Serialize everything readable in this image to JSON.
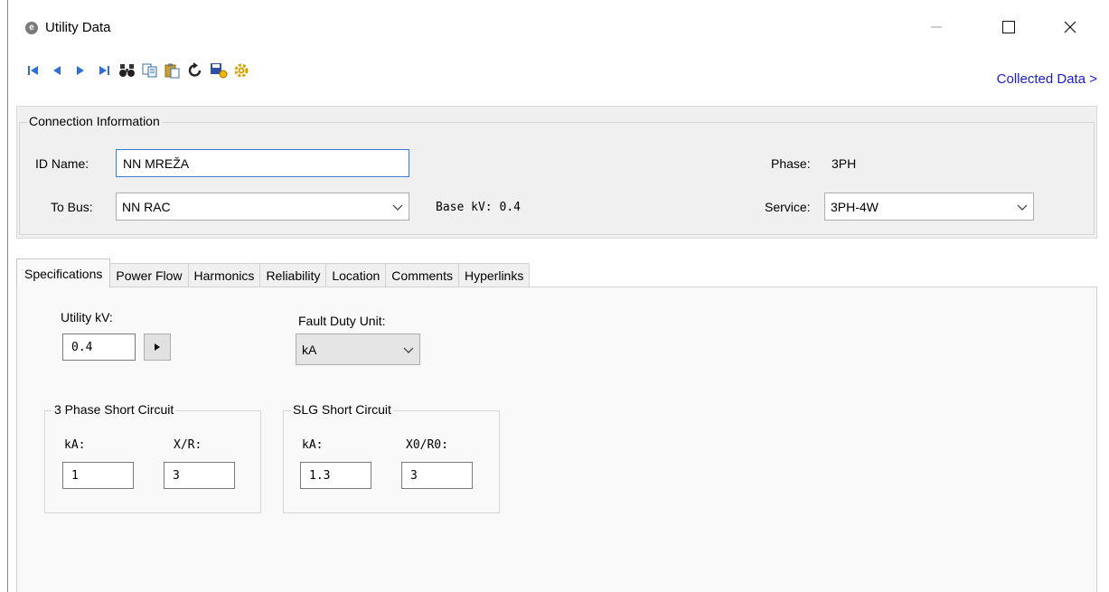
{
  "window": {
    "title": "Utility Data",
    "app_icon_glyph": "e"
  },
  "toolbar": {
    "buttons": [
      {
        "name": "first-record-icon",
        "color": "#2f6fd6"
      },
      {
        "name": "previous-record-icon",
        "color": "#2f6fd6"
      },
      {
        "name": "next-record-icon",
        "color": "#2f6fd6"
      },
      {
        "name": "last-record-icon",
        "color": "#2f6fd6"
      },
      {
        "name": "find-binoculars-icon",
        "color": "#2a2a2a"
      },
      {
        "name": "copy-icon",
        "color": "#3a6ea8"
      },
      {
        "name": "paste-icon",
        "color": "#c9a13a"
      },
      {
        "name": "undo-icon",
        "color": "#222222"
      },
      {
        "name": "save-library-icon",
        "color": "#3050a8"
      },
      {
        "name": "settings-icon",
        "color": "#d8a000"
      }
    ],
    "collected_data_link": "Collected Data >"
  },
  "connection": {
    "legend": "Connection Information",
    "id_label": "ID Name:",
    "id_value": "NN MREŽA",
    "to_bus_label": "To Bus:",
    "to_bus_value": "NN RAC",
    "base_kv_text": "Base kV: 0.4",
    "phase_label": "Phase:",
    "phase_value": "3PH",
    "service_label": "Service:",
    "service_value": "3PH-4W"
  },
  "tabs": [
    {
      "label": "Specifications",
      "active": true
    },
    {
      "label": "Power Flow"
    },
    {
      "label": "Harmonics"
    },
    {
      "label": "Reliability"
    },
    {
      "label": "Location"
    },
    {
      "label": "Comments"
    },
    {
      "label": "Hyperlinks"
    }
  ],
  "specifications": {
    "utility_kv_label": "Utility kV:",
    "utility_kv_value": "0.4",
    "fault_duty_label": "Fault Duty Unit:",
    "fault_duty_value": "kA",
    "three_phase": {
      "legend": "3 Phase Short Circuit",
      "ka_label": "kA:",
      "ka_value": "1",
      "xr_label": "X/R:",
      "xr_value": "3"
    },
    "slg": {
      "legend": "SLG Short Circuit",
      "ka_label": "kA:",
      "ka_value": "1.3",
      "x0r0_label": "X0/R0:",
      "x0r0_value": "3"
    }
  }
}
